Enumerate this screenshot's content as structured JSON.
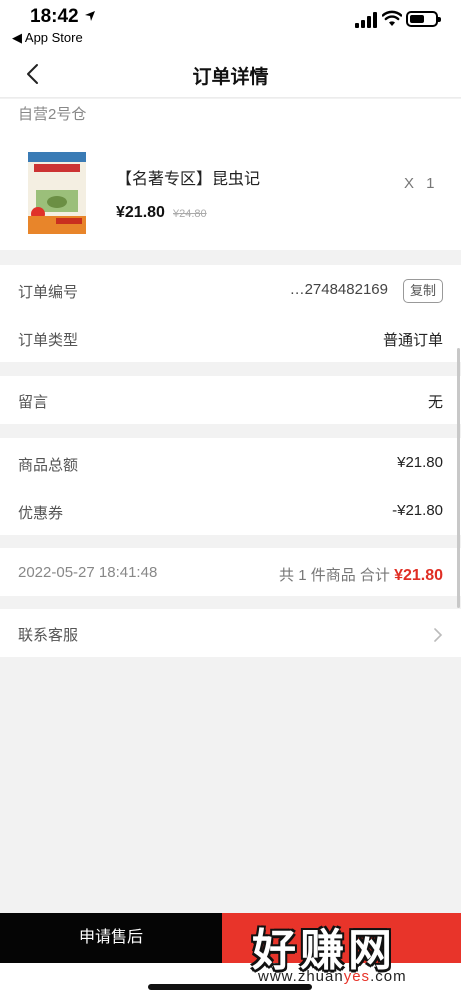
{
  "status": {
    "time": "18:42",
    "back_app": "◀ App Store"
  },
  "nav": {
    "title": "订单详情"
  },
  "warehouse": "自营2号仓",
  "product": {
    "name": "【名著专区】昆虫记",
    "price": "¥21.80",
    "original_price": "¥24.80",
    "quantity": "X 1",
    "cover_title": "昆虫记"
  },
  "order": {
    "number_label": "订单编号",
    "number_value": "…2748482169",
    "copy_label": "复制",
    "type_label": "订单类型",
    "type_value": "普通订单"
  },
  "message": {
    "label": "留言",
    "value": "无"
  },
  "amounts": {
    "goods_total_label": "商品总额",
    "goods_total_value": "¥21.80",
    "coupon_label": "优惠券",
    "coupon_value": "-¥21.80"
  },
  "summary": {
    "datetime": "2022-05-27 18:41:48",
    "count_text": "共 1 件商品  合计 ",
    "total": "¥21.80"
  },
  "service": {
    "label": "联系客服"
  },
  "bottom": {
    "aftersale_label": "申请售后"
  },
  "watermark": {
    "big": "好赚网",
    "url_a": "www.zhuan",
    "url_b": "yes",
    "url_c": ".com"
  },
  "colors": {
    "accent_red": "#e8342a",
    "price_red": "#e02e24"
  }
}
